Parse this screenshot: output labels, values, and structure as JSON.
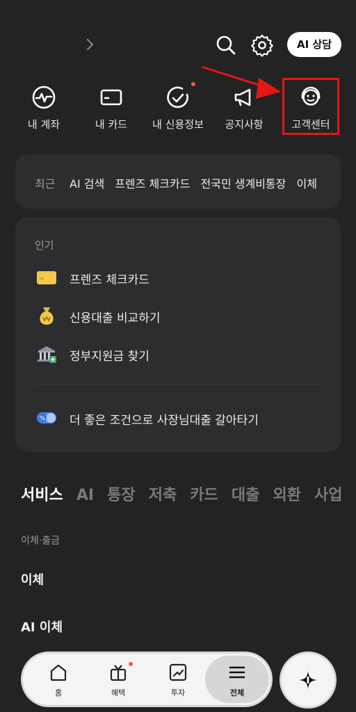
{
  "header": {
    "ai_button_label": "AI 상담"
  },
  "quick_menu": [
    {
      "label": "내 계좌",
      "icon": "account-pulse-icon"
    },
    {
      "label": "내 카드",
      "icon": "card-icon"
    },
    {
      "label": "내 신용정보",
      "icon": "credit-check-icon"
    },
    {
      "label": "공지사항",
      "icon": "megaphone-icon"
    },
    {
      "label": "고객센터",
      "icon": "headset-agent-icon"
    }
  ],
  "recent": {
    "title": "최근",
    "chips": [
      "AI 검색",
      "프렌즈 체크카드",
      "전국민 생계비통장",
      "이체"
    ]
  },
  "popular": {
    "title": "인기",
    "items": [
      {
        "label": "프렌즈 체크카드",
        "icon": "yellow-card-icon"
      },
      {
        "label": "신용대출 비교하기",
        "icon": "money-bag-icon"
      },
      {
        "label": "정부지원금 찾기",
        "icon": "government-building-icon"
      }
    ],
    "promo": {
      "label": "더 좋은 조건으로 사장님대출 갈아타기",
      "icon": "percent-toggle-icon"
    }
  },
  "tabs": [
    "서비스",
    "AI",
    "통장",
    "저축",
    "카드",
    "대출",
    "외환",
    "사업"
  ],
  "active_tab": "서비스",
  "section": {
    "label": "이체·출금",
    "rows": [
      "이체",
      "AI 이체"
    ]
  },
  "bottom_nav": [
    {
      "label": "홈",
      "icon": "home-icon"
    },
    {
      "label": "혜택",
      "icon": "gift-tv-icon"
    },
    {
      "label": "투자",
      "icon": "chart-up-icon"
    },
    {
      "label": "전체",
      "icon": "menu-icon"
    }
  ],
  "colors": {
    "background": "#232323",
    "card": "#2d2d2f",
    "highlight": "#e51616",
    "notification_dot": "#ef5b4c"
  }
}
